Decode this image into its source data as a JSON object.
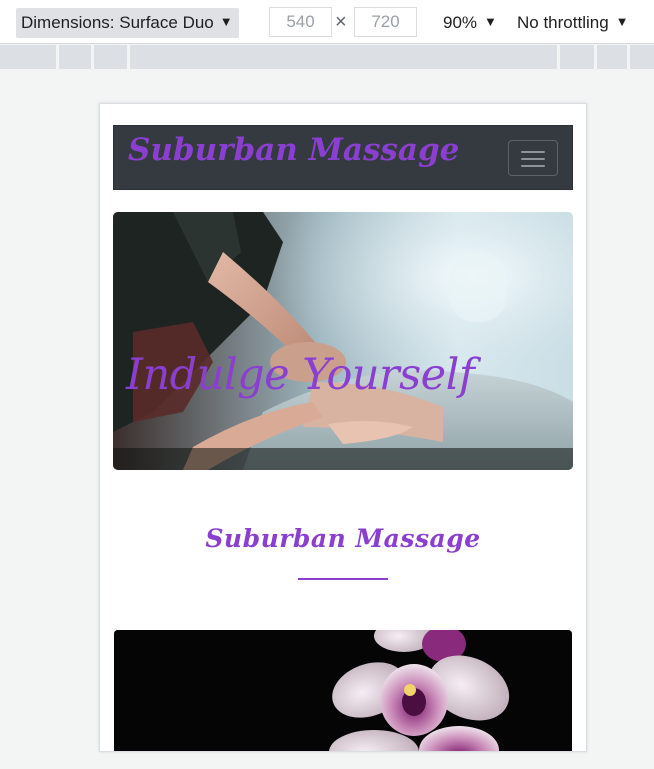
{
  "devtools": {
    "device_label": "Dimensions: Surface Duo",
    "width_value": "540",
    "height_value": "720",
    "times_symbol": "×",
    "zoom_label": "90%",
    "throttle_label": "No throttling",
    "dropdown_arrow": "▼"
  },
  "site": {
    "navbar": {
      "brand": "Suburban Massage",
      "toggler_icon": "hamburger-menu-icon"
    },
    "hero": {
      "title": "Indulge Yourself",
      "image": "massage-photo"
    },
    "section": {
      "title": "Suburban Massage"
    },
    "feature_image": "orchid-photo"
  },
  "colors": {
    "accent": "#8a3fd1",
    "navbar_bg": "#343a40",
    "devtools_select_bg": "#dfe1e5",
    "ruler_bg": "#dcdfe4"
  }
}
